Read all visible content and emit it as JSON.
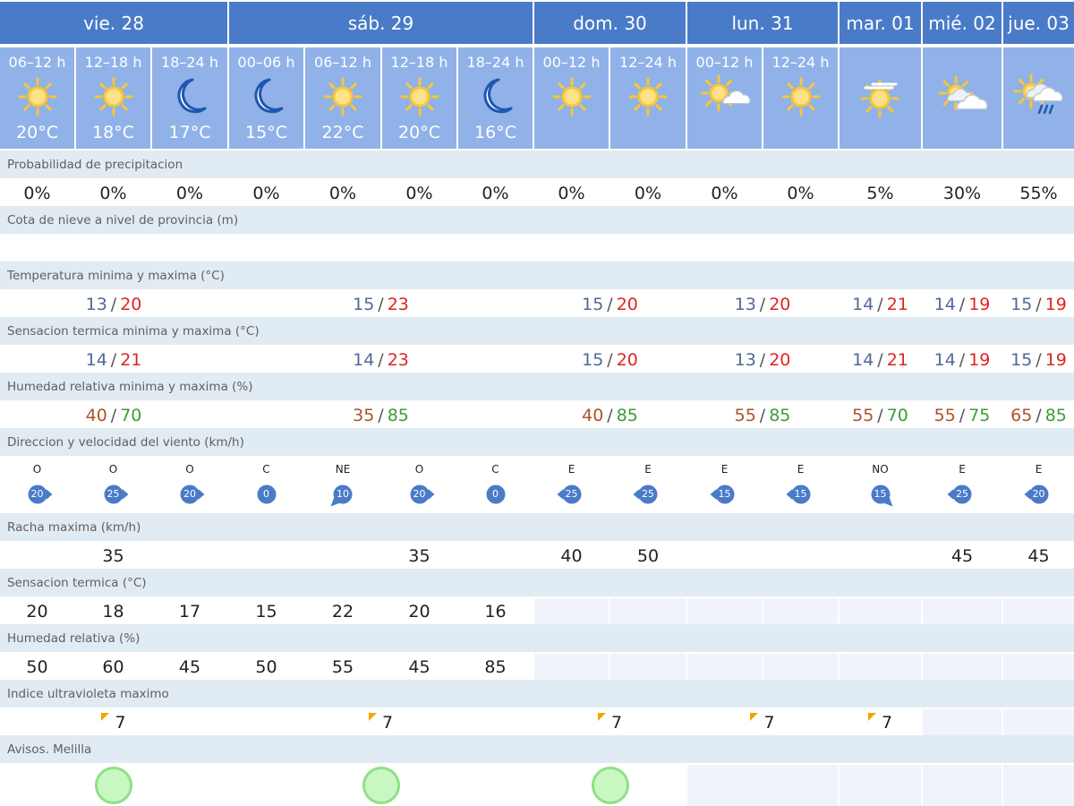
{
  "days": [
    {
      "label": "vie. 28",
      "span": 3
    },
    {
      "label": "sáb. 29",
      "span": 4
    },
    {
      "label": "dom. 30",
      "span": 2
    },
    {
      "label": "lun. 31",
      "span": 2
    },
    {
      "label": "mar. 01",
      "span": 1
    },
    {
      "label": "mié. 02",
      "span": 1
    },
    {
      "label": "jue. 03",
      "span": 1
    }
  ],
  "slots": [
    {
      "period": "06–12 h",
      "icon": "sun-icon",
      "temp": "20°C"
    },
    {
      "period": "12–18 h",
      "icon": "sun-icon",
      "temp": "18°C"
    },
    {
      "period": "18–24 h",
      "icon": "moon-icon",
      "temp": "17°C"
    },
    {
      "period": "00–06 h",
      "icon": "moon-icon",
      "temp": "15°C"
    },
    {
      "period": "06–12 h",
      "icon": "sun-icon",
      "temp": "22°C"
    },
    {
      "period": "12–18 h",
      "icon": "sun-icon",
      "temp": "20°C"
    },
    {
      "period": "18–24 h",
      "icon": "moon-icon",
      "temp": "16°C"
    },
    {
      "period": "00–12 h",
      "icon": "sun-icon",
      "temp": ""
    },
    {
      "period": "12–24 h",
      "icon": "sun-icon",
      "temp": ""
    },
    {
      "period": "00–12 h",
      "icon": "sun-cloud-icon",
      "temp": ""
    },
    {
      "period": "12–24 h",
      "icon": "sun-icon",
      "temp": ""
    },
    {
      "period": "",
      "icon": "sun-haze-icon",
      "temp": ""
    },
    {
      "period": "",
      "icon": "sun-clouds-icon",
      "temp": ""
    },
    {
      "period": "",
      "icon": "rain-cloud-icon",
      "temp": ""
    }
  ],
  "labels": {
    "precip": "Probabilidad de precipitacion",
    "snow": "Cota de nieve a nivel de provincia (m)",
    "temp": "Temperatura minima y maxima (°C)",
    "feel": "Sensacion termica minima y maxima (°C)",
    "humidity": "Humedad relativa minima y maxima (%)",
    "wind": "Direccion y velocidad del viento (km/h)",
    "gust": "Racha maxima (km/h)",
    "feel_slot": "Sensacion termica (°C)",
    "hum_slot": "Humedad relativa (%)",
    "uv": "Indice ultravioleta maximo",
    "warnings": "Avisos. Melilla"
  },
  "precip": [
    "0%",
    "0%",
    "0%",
    "0%",
    "0%",
    "0%",
    "0%",
    "0%",
    "0%",
    "0%",
    "0%",
    "5%",
    "30%",
    "55%"
  ],
  "snow": [
    "",
    "",
    "",
    "",
    "",
    "",
    "",
    "",
    "",
    "",
    "",
    "",
    "",
    ""
  ],
  "temp_minmax": [
    {
      "min": "13",
      "max": "20"
    },
    {
      "min": "15",
      "max": "23"
    },
    {
      "min": "15",
      "max": "20"
    },
    {
      "min": "13",
      "max": "20"
    },
    {
      "min": "14",
      "max": "21"
    },
    {
      "min": "14",
      "max": "19"
    },
    {
      "min": "15",
      "max": "19"
    }
  ],
  "feel_minmax": [
    {
      "min": "14",
      "max": "21"
    },
    {
      "min": "14",
      "max": "23"
    },
    {
      "min": "15",
      "max": "20"
    },
    {
      "min": "13",
      "max": "20"
    },
    {
      "min": "14",
      "max": "21"
    },
    {
      "min": "14",
      "max": "19"
    },
    {
      "min": "15",
      "max": "19"
    }
  ],
  "hum_minmax": [
    {
      "min": "40",
      "max": "70"
    },
    {
      "min": "35",
      "max": "85"
    },
    {
      "min": "40",
      "max": "85"
    },
    {
      "min": "55",
      "max": "85"
    },
    {
      "min": "55",
      "max": "70"
    },
    {
      "min": "55",
      "max": "75"
    },
    {
      "min": "65",
      "max": "85"
    }
  ],
  "wind": [
    {
      "dir": "O",
      "speed": "20"
    },
    {
      "dir": "O",
      "speed": "25"
    },
    {
      "dir": "O",
      "speed": "20"
    },
    {
      "dir": "C",
      "speed": "0"
    },
    {
      "dir": "NE",
      "speed": "10"
    },
    {
      "dir": "O",
      "speed": "20"
    },
    {
      "dir": "C",
      "speed": "0"
    },
    {
      "dir": "E",
      "speed": "25"
    },
    {
      "dir": "E",
      "speed": "25"
    },
    {
      "dir": "E",
      "speed": "15"
    },
    {
      "dir": "E",
      "speed": "15"
    },
    {
      "dir": "NO",
      "speed": "15"
    },
    {
      "dir": "E",
      "speed": "25"
    },
    {
      "dir": "E",
      "speed": "20"
    }
  ],
  "gust": [
    "",
    "35",
    "",
    "",
    "",
    "35",
    "",
    "40",
    "50",
    "",
    "",
    "",
    "45",
    "45"
  ],
  "feel_slot": [
    "20",
    "18",
    "17",
    "15",
    "22",
    "20",
    "16",
    "",
    "",
    "",
    "",
    "",
    "",
    ""
  ],
  "hum_slot": [
    "50",
    "60",
    "45",
    "50",
    "55",
    "45",
    "85",
    "",
    "",
    "",
    "",
    "",
    "",
    ""
  ],
  "uv": [
    "7",
    "7",
    "7",
    "7",
    "7",
    "",
    ""
  ],
  "warnings": [
    "green",
    "green",
    "green",
    "",
    "",
    "",
    ""
  ],
  "colors": {
    "header": "#4a7bc8",
    "subheader": "#90b2e8",
    "label_row": "#e1ebf3",
    "min": "#4f6a96",
    "max": "#e02323",
    "hum_min": "#a9542a",
    "hum_max": "#3d9c36",
    "wind_badge": "#4a7bc8",
    "sun": "#f7c736",
    "uv_mark": "#f5a300",
    "warning_green": "#c9f7c2"
  }
}
